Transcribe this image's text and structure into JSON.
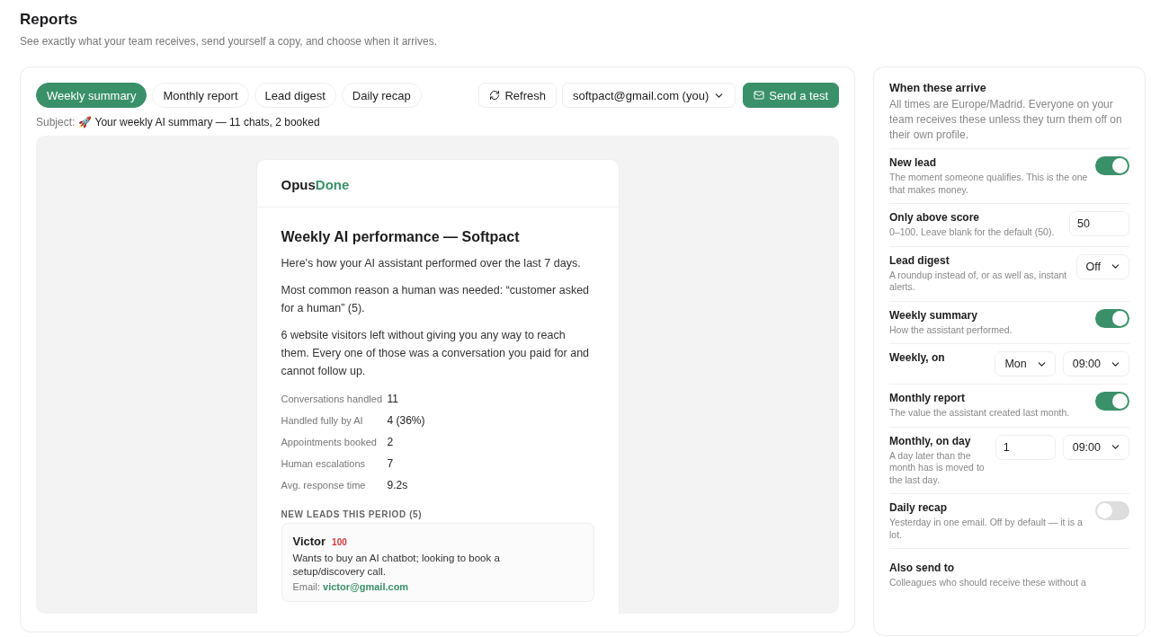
{
  "page": {
    "title": "Reports",
    "subtitle": "See exactly what your team receives, send yourself a copy, and choose when it arrives."
  },
  "tabs": [
    {
      "label": "Weekly summary",
      "selected": true
    },
    {
      "label": "Monthly report",
      "selected": false
    },
    {
      "label": "Lead digest",
      "selected": false
    },
    {
      "label": "Daily recap",
      "selected": false
    }
  ],
  "toolbar": {
    "refresh": "Refresh",
    "recipient": "softpact@gmail.com (you)",
    "send": "Send a test"
  },
  "subject": {
    "label": "Subject:",
    "value": "🚀 Your weekly AI summary — 11 chats, 2 booked"
  },
  "email": {
    "brand": [
      "Opus",
      "Done"
    ],
    "heading": "Weekly AI performance — Softpact",
    "paragraphs": [
      "Here's how your AI assistant performed over the last 7 days.",
      "Most common reason a human was needed: “customer asked for a human” (5).",
      "6 website visitors left without giving you any way to reach them. Every one of those was a conversation you paid for and cannot follow up."
    ],
    "metrics": [
      {
        "label": "Conversations handled",
        "value": "11"
      },
      {
        "label": "Handled fully by AI",
        "value": "4 (36%)"
      },
      {
        "label": "Appointments booked",
        "value": "2"
      },
      {
        "label": "Human escalations",
        "value": "7"
      },
      {
        "label": "Avg. response time",
        "value": "9.2s"
      }
    ],
    "leads_heading": "NEW LEADS THIS PERIOD (5)",
    "leads": [
      {
        "name": "Victor",
        "score": "100",
        "summary": "Wants to buy an AI chatbot; looking to book a setup/discovery call.",
        "email_label": "Email:",
        "email": "victor@gmail.com"
      }
    ]
  },
  "schedule": {
    "title": "When these arrive",
    "description": "All times are Europe/Madrid. Everyone on your team receives these unless they turn them off on their own profile.",
    "rows": [
      {
        "title": "New lead",
        "description": "The moment someone qualifies. This is the one that makes money.",
        "controls": [
          {
            "kind": "toggle",
            "on": true
          }
        ]
      },
      {
        "title": "Only above score",
        "description": "0–100. Leave blank for the default (50).",
        "controls": [
          {
            "kind": "input",
            "value": "50"
          }
        ]
      },
      {
        "title": "Lead digest",
        "description": "A roundup instead of, or as well as, instant alerts.",
        "controls": [
          {
            "kind": "select",
            "value": "Off"
          }
        ]
      },
      {
        "title": "Weekly summary",
        "description": "How the assistant performed.",
        "controls": [
          {
            "kind": "toggle",
            "on": true
          }
        ]
      },
      {
        "title": "Weekly, on",
        "controls": [
          {
            "kind": "select",
            "value": "Mon"
          },
          {
            "kind": "select",
            "value": "09:00"
          }
        ]
      },
      {
        "title": "Monthly report",
        "description": "The value the assistant created last month.",
        "controls": [
          {
            "kind": "toggle",
            "on": true
          }
        ]
      },
      {
        "title": "Monthly, on day",
        "description": "A day later than the month has is moved to the last day.",
        "controls": [
          {
            "kind": "input",
            "value": "1"
          },
          {
            "kind": "select",
            "value": "09:00"
          }
        ]
      },
      {
        "title": "Daily recap",
        "description": "Yesterday in one email. Off by default — it is a lot.",
        "controls": [
          {
            "kind": "toggle",
            "on": false
          }
        ]
      },
      {
        "title": "Also send to",
        "description": "Colleagues who should receive these without a"
      }
    ]
  }
}
